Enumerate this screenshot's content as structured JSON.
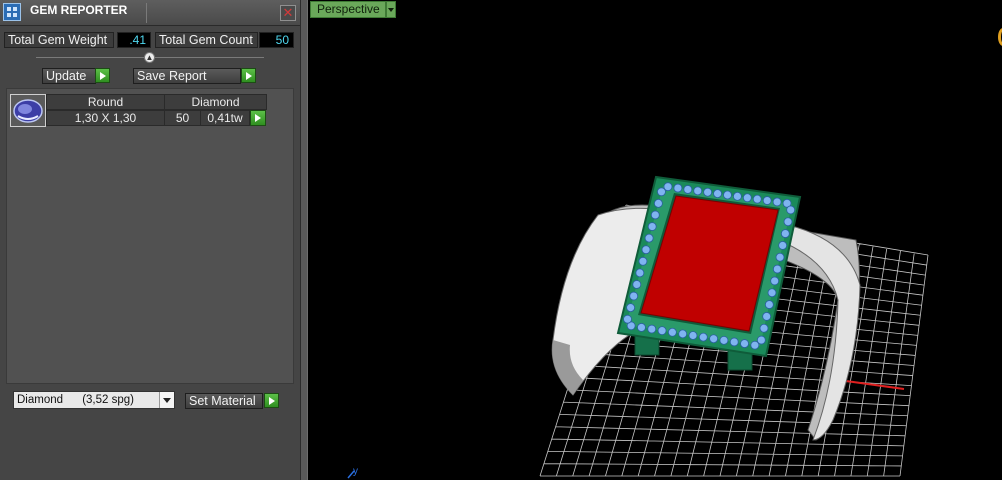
{
  "panel": {
    "title": "GEM REPORTER",
    "close_symbol": "✕",
    "total_weight_label": "Total Gem Weight",
    "total_weight_value": ".41",
    "total_count_label": "Total Gem Count",
    "total_count_value": "50",
    "update_label": "Update",
    "save_report_label": "Save Report",
    "gems": [
      {
        "shape": "Round",
        "material": "Diamond",
        "size": "1,30 X 1,30",
        "count": "50",
        "weight": "0,41tw"
      }
    ],
    "material_select_value": "Diamond      (3,52 spg)",
    "set_material_label": "Set Material"
  },
  "viewport": {
    "view_name": "Perspective",
    "axis_label": "y"
  },
  "colors": {
    "panel_bg": "#454545",
    "value_text": "#4fd8f0",
    "play_green": "#3ea82e",
    "view_tab": "#6aa85a",
    "bezel_green": "#1a8a5a",
    "center_stone_red": "#c00000",
    "melee_blue": "#7fb4f0",
    "band_white": "#e8e8e8",
    "grid_line": "#c8c8c8",
    "axis_red": "#e02020"
  },
  "icons": [
    "gem-reporter-app-icon",
    "close-icon",
    "play-icon",
    "round-gem-icon",
    "dropdown-arrow-icon",
    "axis-y-icon"
  ]
}
